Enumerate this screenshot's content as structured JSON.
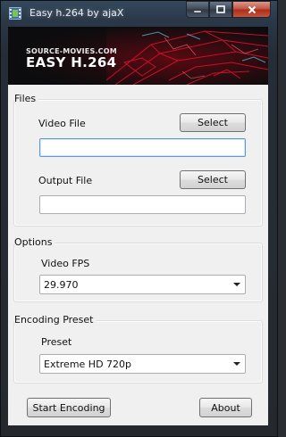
{
  "window": {
    "title": "Easy h.264 by ajaX",
    "icon": "film-strip-icon"
  },
  "banner": {
    "site": "SOURCE-MOVIES.COM",
    "title": "EASY H.264"
  },
  "files": {
    "group_label": "Files",
    "video_file_label": "Video File",
    "video_file_value": "",
    "video_select_label": "Select",
    "output_file_label": "Output File",
    "output_file_value": "",
    "output_select_label": "Select"
  },
  "options": {
    "group_label": "Options",
    "fps_label": "Video FPS",
    "fps_value": "29.970"
  },
  "encoding": {
    "group_label": "Encoding Preset",
    "preset_label": "Preset",
    "preset_value": "Extreme HD 720p"
  },
  "footer": {
    "start_label": "Start Encoding",
    "about_label": "About"
  },
  "colors": {
    "banner_accent": "#d8102a",
    "close_button": "#c1503f"
  }
}
